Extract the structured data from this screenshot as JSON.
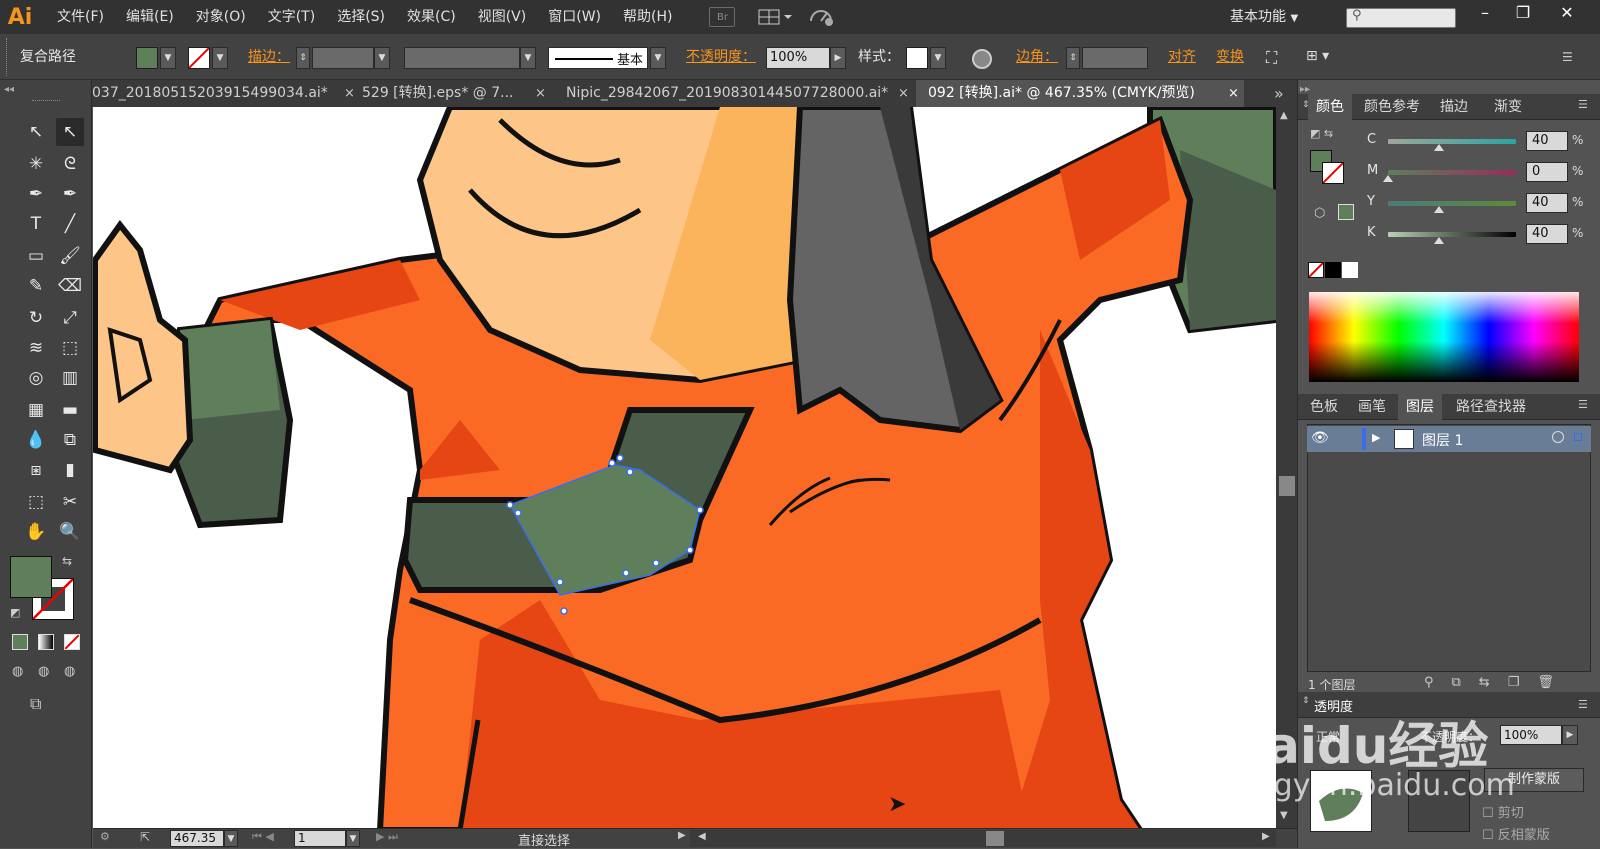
{
  "app": {
    "logo": "Ai",
    "workspace": "基本功能"
  },
  "menu": [
    "文件(F)",
    "编辑(E)",
    "对象(O)",
    "文字(T)",
    "选择(S)",
    "效果(C)",
    "视图(V)",
    "窗口(W)",
    "帮助(H)"
  ],
  "menubar_icons": {
    "bridge": "Br",
    "arrange": "arrange-documents-icon",
    "gpu": "gpu-performance-icon"
  },
  "window_controls": {
    "minimize": "–",
    "restore": "❐",
    "close": "✕"
  },
  "control": {
    "object_type": "复合路径",
    "stroke_label": "描边：",
    "stroke_style": "基本",
    "opacity_label": "不透明度：",
    "opacity_value": "100%",
    "style_label": "样式：",
    "corner_label": "边角：",
    "align_label": "对齐",
    "transform_label": "变换",
    "fill_color": "#5e7f5a"
  },
  "tabs": [
    {
      "label": "037_20180515203915499034.ai*",
      "close": "×"
    },
    {
      "label": "529 [转换].eps* @ 7...",
      "close": "×"
    },
    {
      "label": "Nipic_29842067_20190830144507728000.ai*",
      "close": "×"
    },
    {
      "label": "092 [转换].ai* @ 467.35% (CMYK/预览)",
      "close": "×"
    }
  ],
  "tabs_overflow": "»",
  "status": {
    "zoom": "467.35",
    "artboard": "1",
    "tool_name": "直接选择"
  },
  "panels": {
    "color_tabs": [
      "颜色",
      "颜色参考",
      "描边",
      "渐变"
    ],
    "cmyk": [
      {
        "label": "C",
        "value": "40",
        "pct": "%",
        "level": 0.4
      },
      {
        "label": "M",
        "value": "0",
        "pct": "%",
        "level": 0.0
      },
      {
        "label": "Y",
        "value": "40",
        "pct": "%",
        "level": 0.4
      },
      {
        "label": "K",
        "value": "40",
        "pct": "%",
        "level": 0.4
      }
    ],
    "layer_tabs": [
      "色板",
      "画笔",
      "图层",
      "路径查找器"
    ],
    "layers": [
      {
        "name": "图层",
        "index": "1"
      }
    ],
    "layer_count": "1 个图层",
    "transparency_title": "透明度",
    "blend_mode": "正常",
    "opacity_short": "不透明度：",
    "opacity_value": "100%",
    "make_mask": "制作蒙版",
    "clip": "剪切",
    "invert_mask": "反相蒙版"
  },
  "watermark": {
    "brand": "Baidu经验",
    "url": "jingyan.baidu.com"
  }
}
